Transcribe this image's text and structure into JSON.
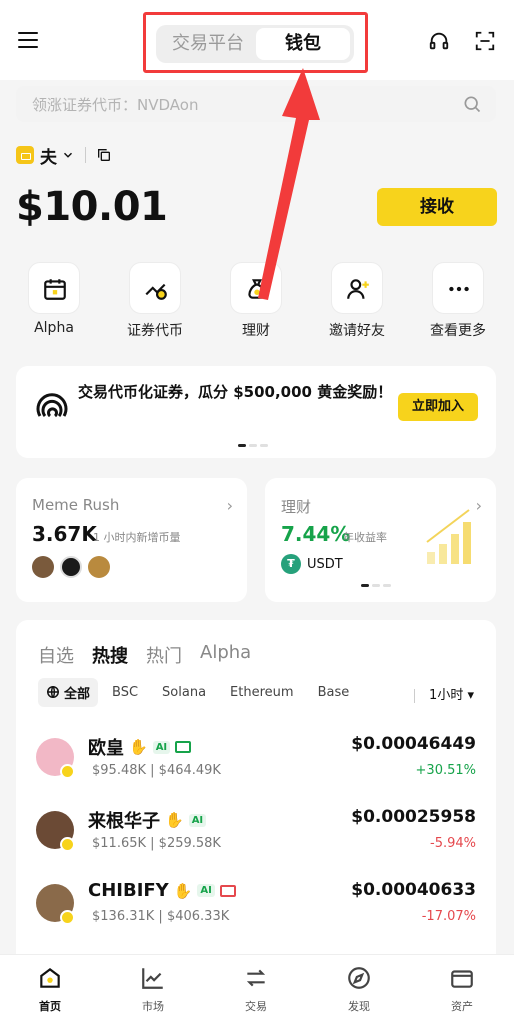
{
  "header": {
    "tabs": [
      {
        "label": "交易平台"
      },
      {
        "label": "钱包"
      }
    ]
  },
  "search": {
    "placeholder": "领涨证券代币：NVDAon"
  },
  "account": {
    "name": "夫"
  },
  "balance": "$10.01",
  "receive_label": "接收",
  "quick_actions": [
    {
      "label": "Alpha",
      "icon": "calendar-icon"
    },
    {
      "label": "证券代币",
      "icon": "chart-coin-icon"
    },
    {
      "label": "理财",
      "icon": "money-bag-icon"
    },
    {
      "label": "邀请好友",
      "icon": "add-user-icon"
    },
    {
      "label": "查看更多",
      "icon": "more-icon"
    }
  ],
  "banner": {
    "text": "交易代币化证券，瓜分 $500,000 黄金奖励！",
    "button": "立即加入"
  },
  "cards": {
    "meme": {
      "title": "Meme Rush",
      "value": "3.67K",
      "sub": "1 小时内新增币量"
    },
    "earn": {
      "title": "理财",
      "value": "7.44%",
      "sub": "年收益率",
      "token": "USDT"
    }
  },
  "market": {
    "tabs": [
      {
        "label": "自选"
      },
      {
        "label": "热搜"
      },
      {
        "label": "热门"
      },
      {
        "label": "Alpha"
      }
    ],
    "active_tab": "热搜",
    "chains": [
      "全部",
      "BSC",
      "Solana",
      "Ethereum",
      "Base"
    ],
    "timeframe": "1小时",
    "rows": [
      {
        "name": "欧皇",
        "mcap": "$95.48K",
        "vol": "$464.49K",
        "price": "$0.00046449",
        "change": "+30.51%",
        "dir": "up",
        "avatar_color": "#f2b8c6"
      },
      {
        "name": "来根华子",
        "mcap": "$11.65K",
        "vol": "$259.58K",
        "price": "$0.00025958",
        "change": "-5.94%",
        "dir": "down",
        "avatar_color": "#6b4a35"
      },
      {
        "name": "CHIBIFY",
        "mcap": "$136.31K",
        "vol": "$406.33K",
        "price": "$0.00040633",
        "change": "-17.07%",
        "dir": "down",
        "avatar_color": "#8a6a4a"
      }
    ],
    "tag_ai": "AI"
  },
  "bottom_nav": [
    {
      "label": "首页",
      "icon": "home-icon"
    },
    {
      "label": "市场",
      "icon": "market-icon"
    },
    {
      "label": "交易",
      "icon": "trade-icon"
    },
    {
      "label": "发现",
      "icon": "discover-icon"
    },
    {
      "label": "资产",
      "icon": "wallet-icon"
    }
  ],
  "colors": {
    "accent": "#f7d31c",
    "up": "#16a34a",
    "down": "#e5484d",
    "highlight": "#f23b3b"
  }
}
